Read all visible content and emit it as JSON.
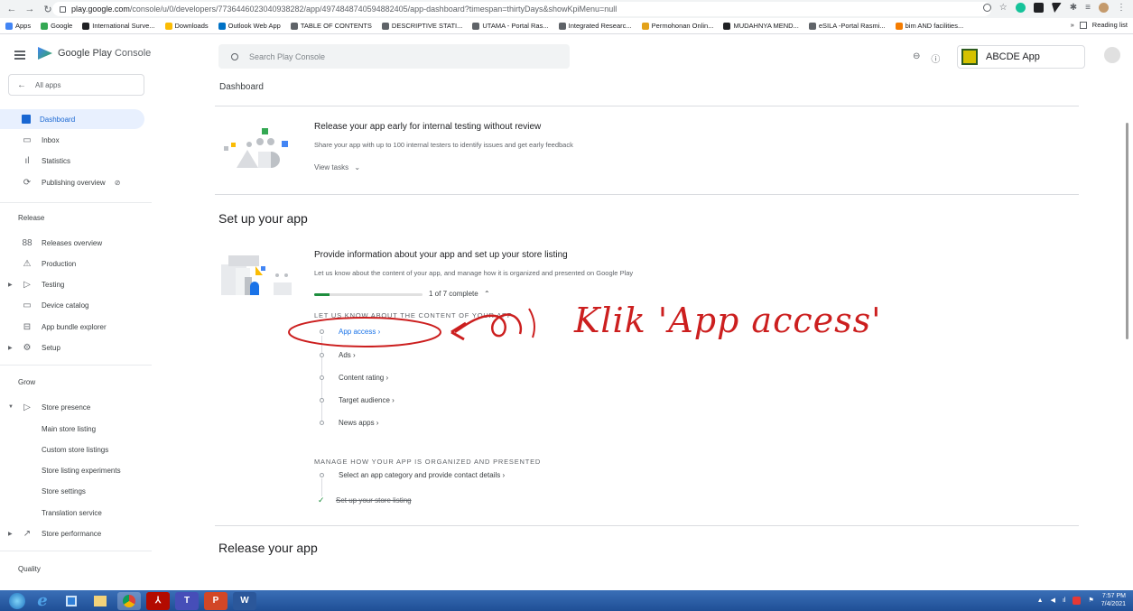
{
  "browser": {
    "url_host": "play.google.com",
    "url_path": "/console/u/0/developers/7736446023040938282/app/4974848740594882405/app-dashboard?timespan=thirtyDays&showKpiMenu=null",
    "bookmarks": [
      {
        "label": "Apps",
        "color": "#4285f4"
      },
      {
        "label": "Google",
        "color": "#34a853"
      },
      {
        "label": "International Surve...",
        "color": "#202124"
      },
      {
        "label": "Downloads",
        "color": "#fbbc04"
      },
      {
        "label": "Outlook Web App",
        "color": "#0072c6"
      },
      {
        "label": "TABLE OF CONTENTS",
        "color": "#5f6368"
      },
      {
        "label": "DESCRIPTIVE STATI...",
        "color": "#5f6368"
      },
      {
        "label": "UTAMA - Portal Ras...",
        "color": "#5f6368"
      },
      {
        "label": "Integrated Researc...",
        "color": "#5f6368"
      },
      {
        "label": "Permohonan Onlin...",
        "color": "#e3a21a"
      },
      {
        "label": "MUDAHNYA MEND...",
        "color": "#202124"
      },
      {
        "label": "eSILA -Portal Rasmi...",
        "color": "#5f6368"
      },
      {
        "label": "bim AND facilities...",
        "color": "#f57c00"
      }
    ],
    "reading_list": "Reading list",
    "more": "»"
  },
  "header": {
    "logo_text_bold": "Google Play",
    "logo_text": "Console",
    "search_placeholder": "Search Play Console",
    "app_name": "ABCDE App"
  },
  "sidebar": {
    "all_apps": "All apps",
    "items": [
      {
        "label": "Dashboard",
        "icon": "▦"
      },
      {
        "label": "Inbox",
        "icon": "▭"
      },
      {
        "label": "Statistics",
        "icon": "ıl"
      },
      {
        "label": "Publishing overview",
        "icon": "⟳"
      }
    ],
    "release_label": "Release",
    "release_items": [
      {
        "label": "Releases overview",
        "icon": "88"
      },
      {
        "label": "Production",
        "icon": "⚠"
      },
      {
        "label": "Testing",
        "icon": "▷"
      },
      {
        "label": "Device catalog",
        "icon": "▭"
      },
      {
        "label": "App bundle explorer",
        "icon": "⊟"
      },
      {
        "label": "Setup",
        "icon": "⚙"
      }
    ],
    "grow_label": "Grow",
    "grow_items": [
      {
        "label": "Store presence",
        "icon": "▷"
      }
    ],
    "grow_sub": [
      "Main store listing",
      "Custom store listings",
      "Store listing experiments",
      "Store settings",
      "Translation service"
    ],
    "store_performance": "Store performance",
    "quality_label": "Quality"
  },
  "main": {
    "breadcrumb": "Dashboard",
    "release_early": {
      "title": "Release your app early for internal testing without review",
      "desc": "Share your app with up to 100 internal testers to identify issues and get early feedback",
      "view_tasks": "View tasks"
    },
    "setup_heading": "Set up your app",
    "setup": {
      "title": "Provide information about your app and set up your store listing",
      "desc": "Let us know about the content of your app, and manage how it is organized and presented on Google Play",
      "progress_text": "1 of 7 complete",
      "progress_fraction": 0.14,
      "content_caps": "LET US KNOW ABOUT THE CONTENT OF YOUR APP",
      "content_tasks": [
        "App access ›",
        "Ads ›",
        "Content rating ›",
        "Target audience ›",
        "News apps ›"
      ],
      "manage_caps": "MANAGE HOW YOUR APP IS ORGANIZED AND PRESENTED",
      "manage_tasks": [
        "Select an app category and provide contact details ›",
        "Set up your store listing"
      ]
    },
    "release_heading": "Release your app"
  },
  "annotation": {
    "text": "Klik 'App access'",
    "color": "#cc1f1f"
  },
  "taskbar": {
    "time": "7:57 PM",
    "date": "7/4/2021"
  }
}
